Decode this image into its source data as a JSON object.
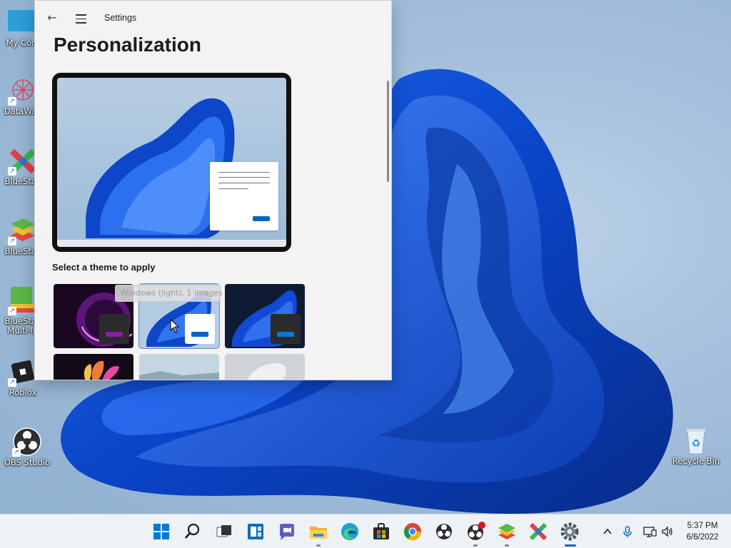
{
  "desktop": {
    "icons": [
      {
        "label": "My Com"
      },
      {
        "label": "DataWag"
      },
      {
        "label": "BlueStac"
      },
      {
        "label": "BlueStac"
      },
      {
        "label": "BlueStac",
        "label2": "Multi-In"
      },
      {
        "label": "Roblox"
      },
      {
        "label": "OBS Studio"
      },
      {
        "label": "Recycle Bin"
      }
    ]
  },
  "settings": {
    "window_title": "Settings",
    "page_title": "Personalization",
    "section_label": "Select a theme to apply",
    "tooltip": "Windows (light), 1 images",
    "accent_color": "#0067c0"
  },
  "taskbar": {
    "icons": [
      "windows-start-icon",
      "search-icon",
      "task-view-icon",
      "widgets-icon",
      "chat-icon",
      "file-explorer-icon",
      "edge-icon",
      "store-icon",
      "chrome-icon",
      "obs-icon",
      "obs-notify-icon",
      "bluestacks-icon",
      "bluestacks-multi-icon",
      "settings-icon"
    ],
    "time": "5:37 PM",
    "date": "6/6/2022"
  }
}
